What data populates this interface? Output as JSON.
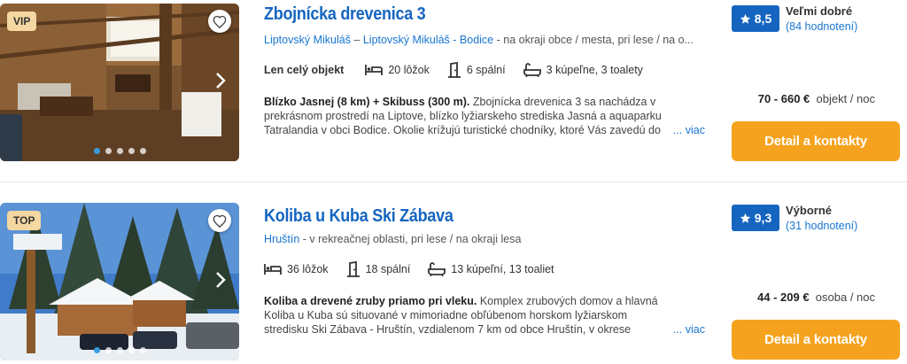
{
  "listings": [
    {
      "badge": "VIP",
      "title": "Zbojnícka drevenica 3",
      "location_links": [
        "Liptovský Mikuláš",
        "Liptovský Mikuláš - Bodice"
      ],
      "location_sep": " – ",
      "location_rest": " - na okraji obce / mesta, pri lese / na o...",
      "object_type": "Len celý objekt",
      "beds": "20 lôžok",
      "bedrooms": "6 spální",
      "bathrooms": "3 kúpeľne, 3 toalety",
      "desc_bold": "Blízko Jasnej (8 km) + Skibuss (300 m).",
      "desc_text": " Zbojnícka drevenica 3 sa nachádza v prekrásnom prostredí na Liptove, blízko lyžiarskeho strediska Jasná a aquaparku Tatralandia v obci Bodice. Okolie krížujú turistické chodníky, ktoré Vás zavedú do",
      "more": "... viac",
      "rating": "8,5",
      "rating_label": "Veľmi dobré",
      "rating_count": "(84 hodnotení)",
      "price": "70 - 660 €",
      "price_unit": "objekt / noc",
      "cta": "Detail a kontakty",
      "photo_dots": 5,
      "active_dot": 0
    },
    {
      "badge": "TOP",
      "title": "Koliba u Kuba Ski Zábava",
      "location_links": [
        "Hruštín"
      ],
      "location_sep": "",
      "location_rest": " - v rekreačnej oblasti, pri lese / na okraji lesa",
      "object_type": "",
      "beds": "36 lôžok",
      "bedrooms": "18 spální",
      "bathrooms": "13 kúpeľní, 13 toaliet",
      "desc_bold": "Koliba a drevené zruby priamo pri vleku.",
      "desc_text": " Komplex zrubových domov a hlavná Koliba u Kuba sú situované v mimoriadne obľúbenom horskom lyžiarskom stredisku Ski Zábava - Hruštín, vzdialenom 7 km od obce Hruštín, v okrese Námestovo.",
      "more": "... viac",
      "rating": "9,3",
      "rating_label": "Výborné",
      "rating_count": "(31 hodnotení)",
      "price": "44 - 209 €",
      "price_unit": "osoba / noc",
      "cta": "Detail a kontakty",
      "photo_dots": 5,
      "active_dot": 0
    }
  ],
  "colors": {
    "link": "#1976d2",
    "title": "#1565c0",
    "rating_bg": "#1565c0",
    "cta": "#f5a31e",
    "badge": "#f4d7a1"
  }
}
